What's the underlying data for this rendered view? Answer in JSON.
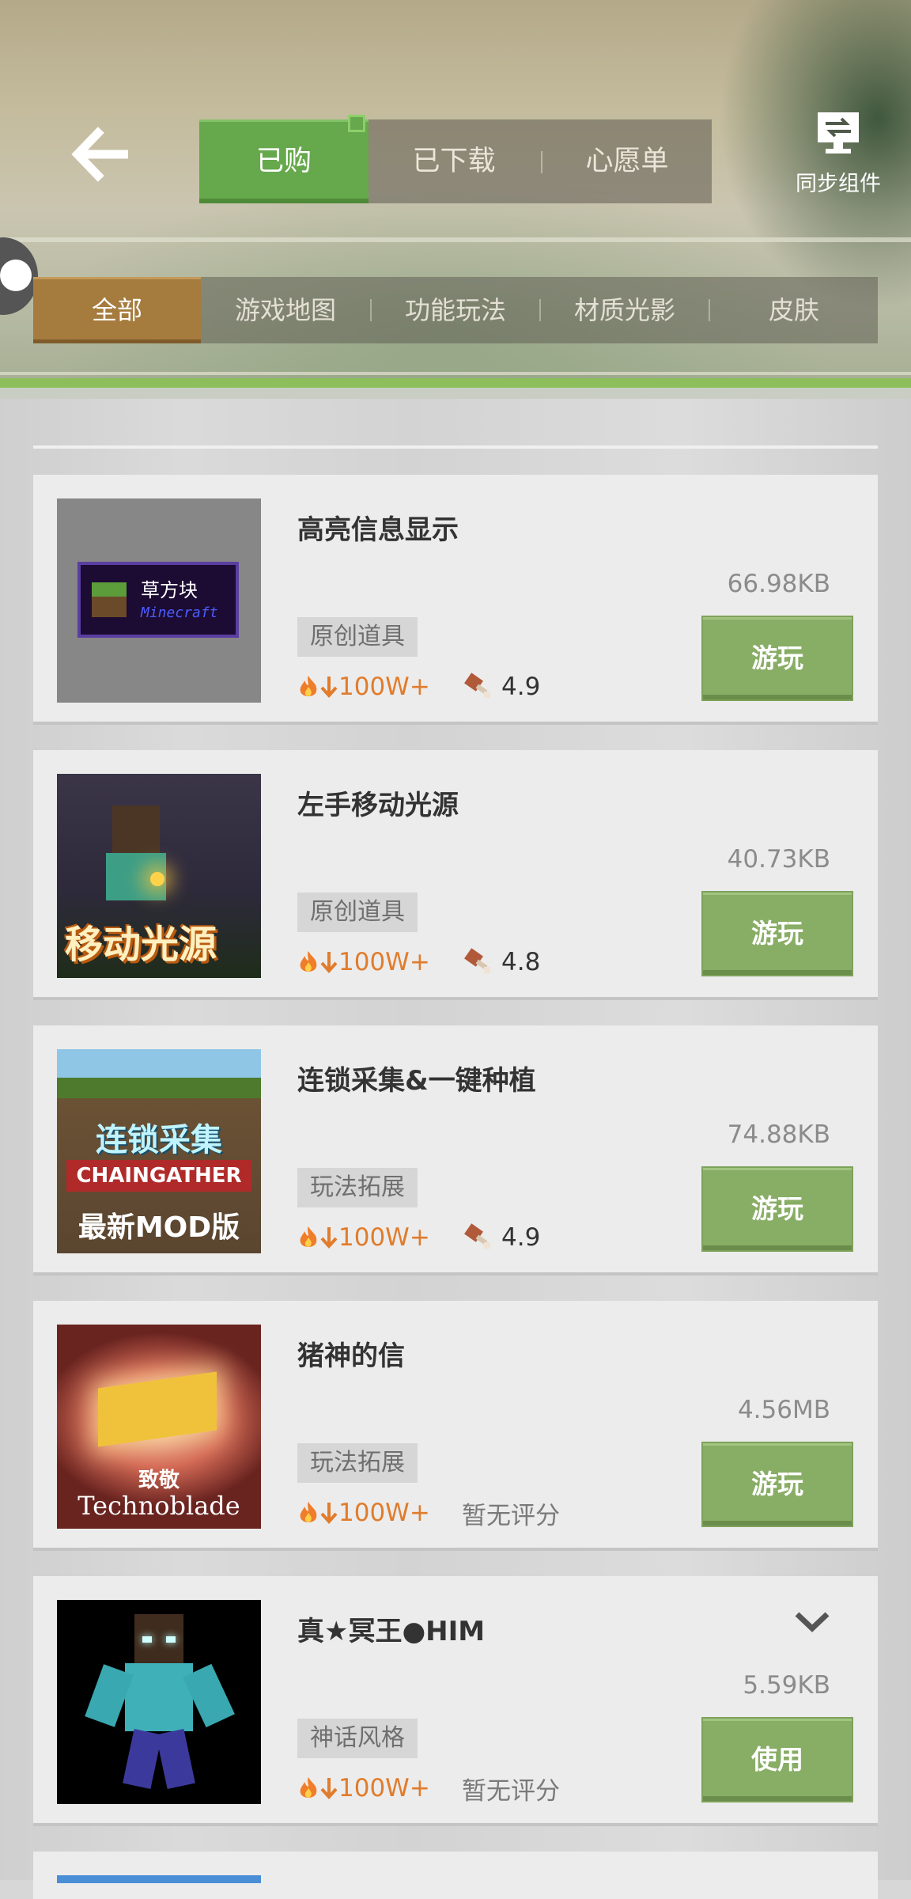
{
  "header": {
    "back_icon": "arrow-left-icon",
    "tabs": [
      {
        "label": "已购",
        "active": true
      },
      {
        "label": "已下载",
        "active": false
      },
      {
        "label": "心愿单",
        "active": false
      }
    ],
    "sync": {
      "icon": "sync-monitor-icon",
      "label": "同步组件"
    }
  },
  "filters": [
    {
      "label": "全部",
      "active": true
    },
    {
      "label": "游戏地图",
      "active": false
    },
    {
      "label": "功能玩法",
      "active": false
    },
    {
      "label": "材质光影",
      "active": false
    },
    {
      "label": "皮肤",
      "active": false
    }
  ],
  "colors": {
    "accent_green": "#66a84c",
    "filter_active": "#a57b3e",
    "button_green": "#88ad65",
    "downloads_orange": "#e07c2c"
  },
  "items": [
    {
      "title": "高亮信息显示",
      "size": "66.98KB",
      "tag": "原创道具",
      "downloads": "100W+",
      "rating": "4.9",
      "action": "游玩",
      "thumb": {
        "caption": "草方块",
        "sub": "Minecraft"
      }
    },
    {
      "title": "左手移动光源",
      "size": "40.73KB",
      "tag": "原创道具",
      "downloads": "100W+",
      "rating": "4.8",
      "action": "游玩",
      "thumb": {
        "caption": "移动光源"
      }
    },
    {
      "title": "连锁采集&一键种植",
      "size": "74.88KB",
      "tag": "玩法拓展",
      "downloads": "100W+",
      "rating": "4.9",
      "action": "游玩",
      "thumb": {
        "line1": "连锁采集",
        "line2": "CHAINGATHER",
        "line3": "最新MOD版"
      }
    },
    {
      "title": "猪神的信",
      "size": "4.56MB",
      "tag": "玩法拓展",
      "downloads": "100W+",
      "rating": "暂无评分",
      "action": "游玩",
      "thumb": {
        "line1": "致敬",
        "line2": "Technoblade"
      }
    },
    {
      "title": "真★冥王●HIM",
      "size": "5.59KB",
      "tag": "神话风格",
      "downloads": "100W+",
      "rating": "暂无评分",
      "action": "使用",
      "has_expand": true
    }
  ]
}
